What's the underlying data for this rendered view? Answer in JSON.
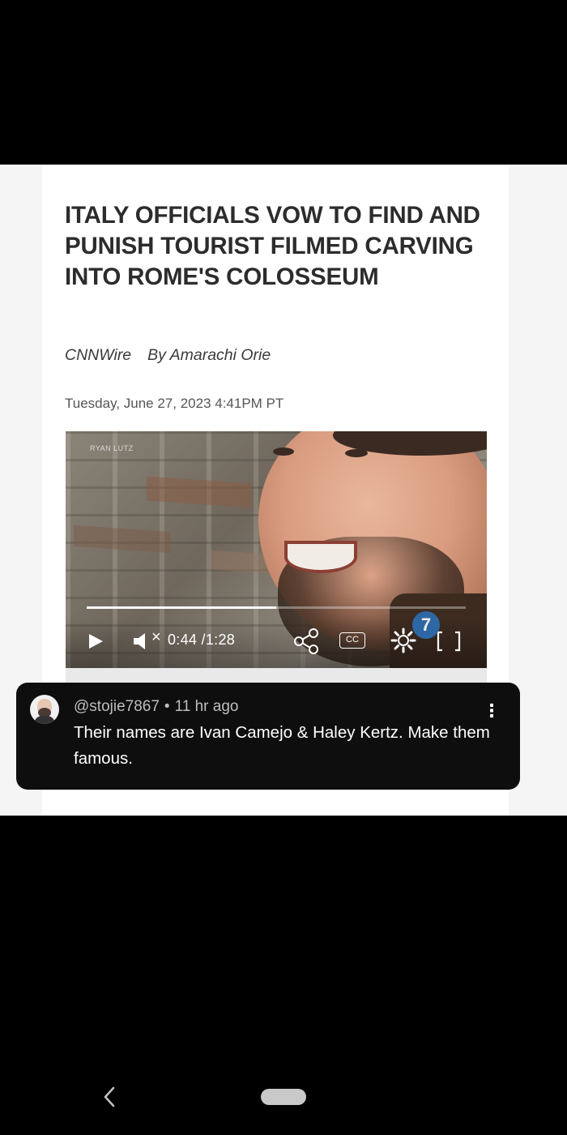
{
  "article": {
    "headline": "ITALY OFFICIALS VOW TO FIND AND PUNISH TOURIST FILMED CARVING INTO ROME'S COLOSSEUM",
    "source": "CNNWire",
    "author": "By Amarachi Orie",
    "date": "Tuesday, June 27, 2023 4:41PM PT"
  },
  "video": {
    "watermark": "RYAN LUTZ",
    "current_time": "0:44",
    "total_time": "/1:28",
    "mute_symbol": "×",
    "cc_label": "CC",
    "progress_fraction": 0.5,
    "channel_logo": "7"
  },
  "comment": {
    "username": "@stojie7867",
    "separator": "•",
    "time_ago": "11 hr ago",
    "text": "Their names are Ivan Camejo & Haley Kertz. Make them famous.",
    "menu_symbol": "⋮"
  },
  "icons": {
    "play": "play-icon",
    "mute": "speaker-mute-icon",
    "share": "share-icon",
    "cc": "closed-captions-icon",
    "settings": "gear-icon",
    "fullscreen": "fullscreen-icon",
    "back": "chevron-left-icon"
  },
  "colors": {
    "comment_bg": "#0e0e0e",
    "page_bg": "#ffffff",
    "headline": "#2c2c2c"
  }
}
